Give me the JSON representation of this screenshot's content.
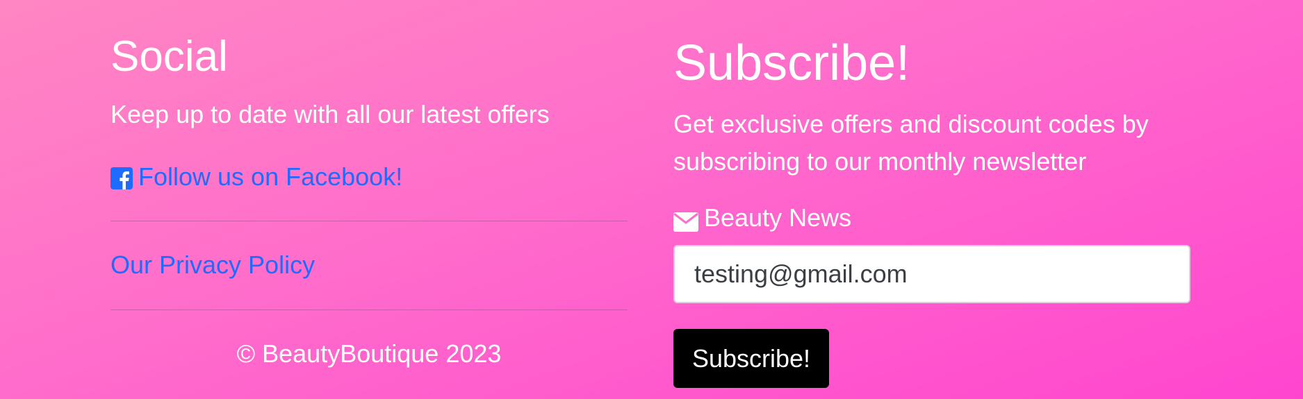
{
  "colors": {
    "background_start": "#ff86c3",
    "background_end": "#ff45cf",
    "text": "#ffffff",
    "link": "#1f6bff",
    "button_bg": "#000000",
    "button_text": "#ffffff",
    "input_text": "#3b3f44"
  },
  "social": {
    "heading": "Social",
    "description": "Keep up to date with all our latest offers",
    "facebook": {
      "icon": "facebook-square-icon",
      "label": "Follow us on Facebook!"
    },
    "privacy_link": "Our Privacy Policy",
    "copyright": "© BeautyBoutique 2023"
  },
  "subscribe": {
    "heading": "Subscribe!",
    "description": "Get exclusive offers and discount codes by subscribing to our monthly newsletter",
    "newsletter": {
      "icon": "envelope-icon",
      "label": "Beauty News"
    },
    "email_value": "testing@gmail.com",
    "button_label": "Subscribe!"
  }
}
